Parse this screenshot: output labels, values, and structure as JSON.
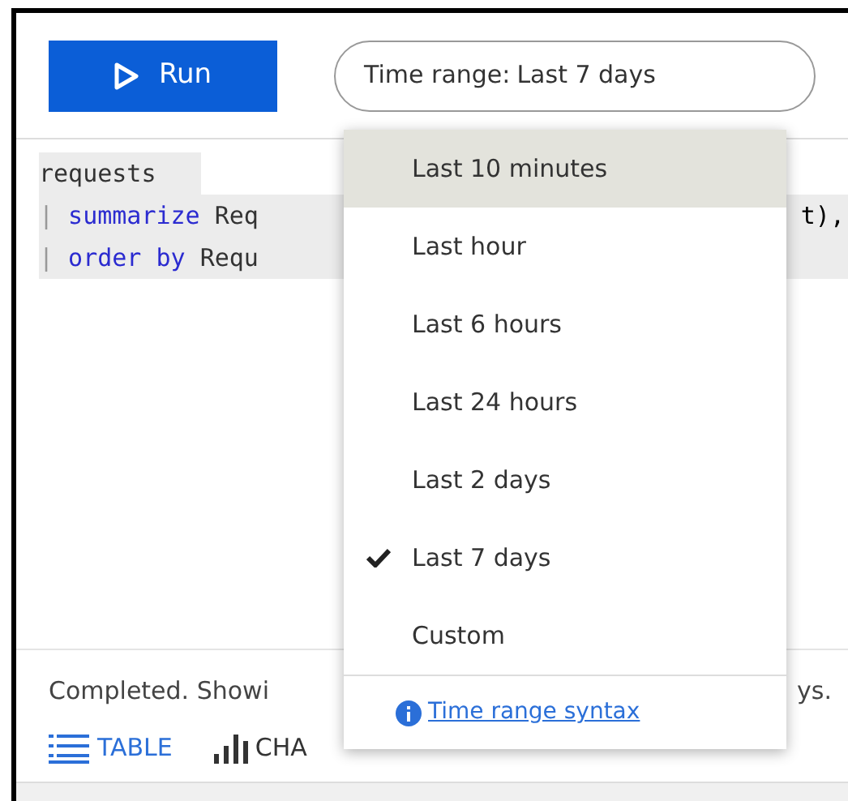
{
  "toolbar": {
    "run_button": "Run",
    "time_range": {
      "label": "Time range:",
      "value": "Last 7 days"
    }
  },
  "code_lines": [
    {
      "parts": [
        {
          "kind": "plain",
          "text": "requests"
        }
      ]
    },
    {
      "parts": [
        {
          "kind": "pipe",
          "text": "|"
        },
        {
          "kind": "keyword",
          "text": "summarize"
        },
        {
          "kind": "plain",
          "text": "Req"
        }
      ],
      "tail": "t),"
    },
    {
      "parts": [
        {
          "kind": "pipe",
          "text": "|"
        },
        {
          "kind": "keyword",
          "text": "order by"
        },
        {
          "kind": "plain",
          "text": "Requ"
        }
      ]
    }
  ],
  "status": {
    "left": "Completed. Showi",
    "right": "ys."
  },
  "view_tabs": [
    {
      "label": "TABLE",
      "kind": "table",
      "selected": true
    },
    {
      "label": "CHA",
      "kind": "chart",
      "selected": false
    }
  ],
  "menu": {
    "items": [
      {
        "label": "Last 10 minutes",
        "selected": false,
        "highlighted": true
      },
      {
        "label": "Last hour",
        "selected": false,
        "highlighted": false
      },
      {
        "label": "Last 6 hours",
        "selected": false,
        "highlighted": false
      },
      {
        "label": "Last 24 hours",
        "selected": false,
        "highlighted": false
      },
      {
        "label": "Last 2 days",
        "selected": false,
        "highlighted": false
      },
      {
        "label": "Last 7 days",
        "selected": true,
        "highlighted": false
      },
      {
        "label": "Custom",
        "selected": false,
        "highlighted": false
      }
    ],
    "link": "Time range syntax"
  }
}
